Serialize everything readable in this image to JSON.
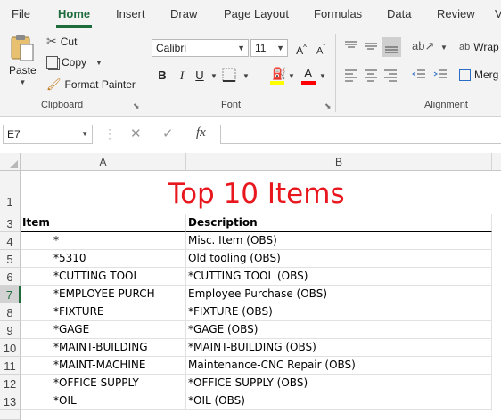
{
  "tabs": [
    "File",
    "Home",
    "Insert",
    "Draw",
    "Page Layout",
    "Formulas",
    "Data",
    "Review",
    "V"
  ],
  "active_tab": "Home",
  "clipboard": {
    "paste_label": "Paste",
    "cut_label": "Cut",
    "copy_label": "Copy",
    "format_painter_label": "Format Painter",
    "group_label": "Clipboard"
  },
  "font": {
    "font_name": "Calibri",
    "font_size": "11",
    "bold": "B",
    "italic": "I",
    "underline": "U",
    "grow": "A^",
    "shrink": "Aˇ",
    "font_color_letter": "A",
    "group_label": "Font",
    "highlight_color": "#ffff00",
    "font_color": "#ff0000"
  },
  "alignment": {
    "wrap_label": "Wrap",
    "merge_label": "Merg",
    "group_label": "Alignment"
  },
  "formula_bar": {
    "name_box": "E7",
    "cancel_icon": "✕",
    "enter_icon": "✓",
    "fx_label": "fx",
    "formula": ""
  },
  "columns": [
    "A",
    "B"
  ],
  "title_row": "1",
  "title_text": "Top 10 Items",
  "header_row": {
    "row": "3",
    "item": "Item",
    "description": "Description"
  },
  "rows": [
    {
      "row": "4",
      "item": "*",
      "description": "Misc. Item (OBS)"
    },
    {
      "row": "5",
      "item": "*5310",
      "description": "Old tooling (OBS)"
    },
    {
      "row": "6",
      "item": "*CUTTING TOOL",
      "description": "*CUTTING TOOL (OBS)"
    },
    {
      "row": "7",
      "item": "*EMPLOYEE PURCH",
      "description": "Employee Purchase (OBS)"
    },
    {
      "row": "8",
      "item": "*FIXTURE",
      "description": "*FIXTURE (OBS)"
    },
    {
      "row": "9",
      "item": "*GAGE",
      "description": "*GAGE (OBS)"
    },
    {
      "row": "10",
      "item": "*MAINT-BUILDING",
      "description": "*MAINT-BUILDING (OBS)"
    },
    {
      "row": "11",
      "item": "*MAINT-MACHINE",
      "description": "Maintenance-CNC Repair (OBS)"
    },
    {
      "row": "12",
      "item": "*OFFICE SUPPLY",
      "description": "*OFFICE SUPPLY (OBS)"
    },
    {
      "row": "13",
      "item": "*OIL",
      "description": "*OIL (OBS)"
    }
  ],
  "selected_row": "7",
  "colors": {
    "accent": "#1e6b3c",
    "title": "#e8161d"
  }
}
